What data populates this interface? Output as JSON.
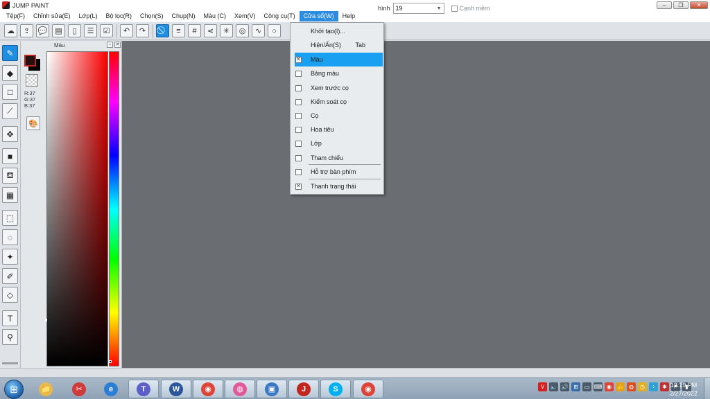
{
  "window": {
    "title": "JUMP PAINT",
    "controls": {
      "minimize": "–",
      "maximize": "❐",
      "close": "✕"
    }
  },
  "menubar": {
    "items": [
      {
        "label": "Tệp(F)"
      },
      {
        "label": "Chỉnh sửa(E)"
      },
      {
        "label": "Lớp(L)"
      },
      {
        "label": "Bộ lọc(R)"
      },
      {
        "label": "Chọn(S)"
      },
      {
        "label": "Chụp(N)"
      },
      {
        "label": "Màu (C)"
      },
      {
        "label": "Xem(V)"
      },
      {
        "label": "Công cụ(T)"
      },
      {
        "label": "Cửa sổ(W)",
        "active": true
      },
      {
        "label": "Help"
      }
    ]
  },
  "toolbar": {
    "buttons": [
      {
        "icon": "cloud-icon",
        "glyph": "☁"
      },
      {
        "icon": "share-icon",
        "glyph": "⇪"
      },
      {
        "icon": "speech-bubble-icon",
        "glyph": "💬"
      },
      {
        "icon": "comment-icon",
        "glyph": "▤"
      },
      {
        "icon": "document-icon",
        "glyph": "▯"
      },
      {
        "icon": "list-icon",
        "glyph": "☰"
      },
      {
        "icon": "checklist-icon",
        "glyph": "☑"
      },
      {
        "icon": "undo-icon",
        "glyph": "↶"
      },
      {
        "icon": "redo-icon",
        "glyph": "↷"
      },
      {
        "icon": "no-ruler-icon",
        "glyph": "⃠"
      },
      {
        "icon": "parallel-lines-icon",
        "glyph": "≡"
      },
      {
        "icon": "grid-icon",
        "glyph": "#"
      },
      {
        "icon": "perspective-icon",
        "glyph": "⋖"
      },
      {
        "icon": "radial-lines-icon",
        "glyph": "✳"
      },
      {
        "icon": "concentric-circles-icon",
        "glyph": "◎"
      },
      {
        "icon": "curve-icon",
        "glyph": "∿"
      },
      {
        "icon": "circle-icon",
        "glyph": "○"
      }
    ],
    "size_label": "hình",
    "size_value": "19",
    "smooth_edge_label": "Cạnh mềm"
  },
  "tools": [
    {
      "icon": "brush-icon",
      "glyph": "✎",
      "selected": true
    },
    {
      "icon": "eraser-icon",
      "glyph": "◆"
    },
    {
      "icon": "rectangle-icon",
      "glyph": "□"
    },
    {
      "icon": "line-icon",
      "glyph": "⟋"
    },
    {
      "icon": "move-icon",
      "glyph": "✥"
    },
    {
      "icon": "fill-rectangle-icon",
      "glyph": "■"
    },
    {
      "icon": "paint-bucket-icon",
      "glyph": "⛾"
    },
    {
      "icon": "gradient-icon",
      "glyph": "▦"
    },
    {
      "icon": "rect-select-icon",
      "glyph": "⬚"
    },
    {
      "icon": "lasso-icon",
      "glyph": "◌"
    },
    {
      "icon": "magic-wand-icon",
      "glyph": "✦"
    },
    {
      "icon": "select-pen-icon",
      "glyph": "✐"
    },
    {
      "icon": "select-eraser-icon",
      "glyph": "◇"
    },
    {
      "icon": "text-icon",
      "glyph": "T"
    },
    {
      "icon": "eyedropper-icon",
      "glyph": "⚲"
    }
  ],
  "color_panel": {
    "title": "Màu",
    "r": "R:37",
    "g": "G:37",
    "b": "B:37",
    "hue_fraction": 0.99
  },
  "window_menu": {
    "items": [
      {
        "label": "Khởi tạo(I)...",
        "has_checkbox": false,
        "shortcut": ""
      },
      {
        "label": "Hiện/Ẩn(S)",
        "has_checkbox": false,
        "shortcut": "Tab"
      },
      {
        "label": "Màu",
        "has_checkbox": true,
        "checked": true,
        "highlighted": true,
        "shortcut": ""
      },
      {
        "label": "Bảng màu",
        "has_checkbox": true,
        "checked": false,
        "shortcut": ""
      },
      {
        "label": "Xem trước cọ",
        "has_checkbox": true,
        "checked": false,
        "shortcut": ""
      },
      {
        "label": "Kiểm soát cọ",
        "has_checkbox": true,
        "checked": false,
        "shortcut": ""
      },
      {
        "label": "Cọ",
        "has_checkbox": true,
        "checked": false,
        "shortcut": ""
      },
      {
        "label": "Hoa tiêu",
        "has_checkbox": true,
        "checked": false,
        "shortcut": ""
      },
      {
        "label": "Lớp",
        "has_checkbox": true,
        "checked": false,
        "shortcut": ""
      },
      {
        "label": "Tham chiếu",
        "has_checkbox": true,
        "checked": false,
        "shortcut": ""
      },
      {
        "label": "Hỗ trợ bàn phím",
        "has_checkbox": true,
        "checked": false,
        "shortcut": ""
      },
      {
        "label": "Thanh trạng thái",
        "has_checkbox": true,
        "checked": true,
        "shortcut": ""
      }
    ]
  },
  "taskbar": {
    "apps": [
      {
        "icon": "file-explorer-icon",
        "glyph": "📁",
        "color": "#e8b84a",
        "open": false
      },
      {
        "icon": "snipping-tool-icon",
        "glyph": "✂",
        "color": "#d03a3a",
        "open": false
      },
      {
        "icon": "internet-explorer-icon",
        "glyph": "e",
        "color": "#2a7fd4",
        "open": false
      },
      {
        "icon": "teams-icon",
        "glyph": "T",
        "color": "#5b5fc7",
        "open": true
      },
      {
        "icon": "word-icon",
        "glyph": "W",
        "color": "#2b579a",
        "open": true
      },
      {
        "icon": "chrome-icon",
        "glyph": "◉",
        "color": "#db4437",
        "open": true
      },
      {
        "icon": "color-app-icon",
        "glyph": "◍",
        "color": "#e05a9a",
        "open": true
      },
      {
        "icon": "remote-desktop-icon",
        "glyph": "▣",
        "color": "#3b78c4",
        "open": true
      },
      {
        "icon": "jump-paint-icon",
        "glyph": "J",
        "color": "#c0261e",
        "open": true
      },
      {
        "icon": "skype-icon",
        "glyph": "S",
        "color": "#00aff0",
        "open": true
      },
      {
        "icon": "chrome-profile-icon",
        "glyph": "◉",
        "color": "#db4437",
        "open": true
      }
    ],
    "tray": [
      {
        "icon": "antivirus-icon",
        "glyph": "V",
        "color": "#d42020"
      },
      {
        "icon": "volume-icon",
        "glyph": "🔈",
        "color": "#4a5a6a"
      },
      {
        "icon": "speaker-icon",
        "glyph": "🔊",
        "color": "#4a5a6a"
      },
      {
        "icon": "network-icon",
        "glyph": "⊞",
        "color": "#3a6ea8"
      },
      {
        "icon": "monitor-icon",
        "glyph": "▭",
        "color": "#4a5a6a"
      },
      {
        "icon": "keyboard-icon",
        "glyph": "⌨",
        "color": "#4a5a6a"
      },
      {
        "icon": "chrome-tray-icon",
        "glyph": "◉",
        "color": "#db4437"
      },
      {
        "icon": "thumbs-up-icon",
        "glyph": "👍",
        "color": "#e0a020"
      },
      {
        "icon": "globe-icon",
        "glyph": "◍",
        "color": "#d85020"
      },
      {
        "icon": "clock-app-icon",
        "glyph": "◷",
        "color": "#e0b020"
      },
      {
        "icon": "dots-icon",
        "glyph": "⁘",
        "color": "#30a0d0"
      },
      {
        "icon": "tools-icon",
        "glyph": "✱",
        "color": "#c03030"
      },
      {
        "icon": "flag-icon",
        "glyph": "⚑",
        "color": "#4a5a6a"
      },
      {
        "icon": "signal-icon",
        "glyph": "▮",
        "color": "#4a5a6a"
      }
    ],
    "time": "12:19 PM",
    "date": "2/27/2022"
  }
}
